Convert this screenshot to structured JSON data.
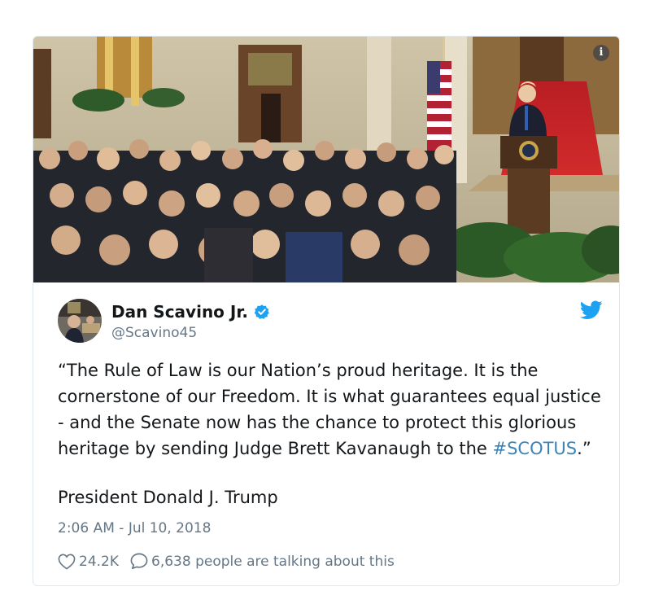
{
  "tweet": {
    "author_name": "Dan Scavino Jr.",
    "author_handle": "@Scavino45",
    "text_before": "“The Rule of Law is our Nation’s proud heritage. It is the cornerstone of our Freedom. It is what guarantees equal justice - and the Senate now has the chance to protect this glorious heritage by sending Judge Brett Kavanaugh to the ",
    "hashtag": "#SCOTUS",
    "text_after": ".”",
    "signature": "President Donald J. Trump",
    "timestamp": "2:06 AM - Jul 10, 2018",
    "likes": "24.2K",
    "talking": "6,638 people are talking about this"
  },
  "media": {
    "info_glyph": "i"
  },
  "icons": {
    "info": "info-icon",
    "verified": "verified-badge-icon",
    "brand": "twitter-bird-icon",
    "like": "heart-icon",
    "reply": "speech-bubble-icon"
  },
  "colors": {
    "link": "#3b84b8",
    "twitter_blue": "#1da1f2",
    "text_primary": "#14171a",
    "text_secondary": "#657786",
    "border": "#e1e8ed"
  }
}
